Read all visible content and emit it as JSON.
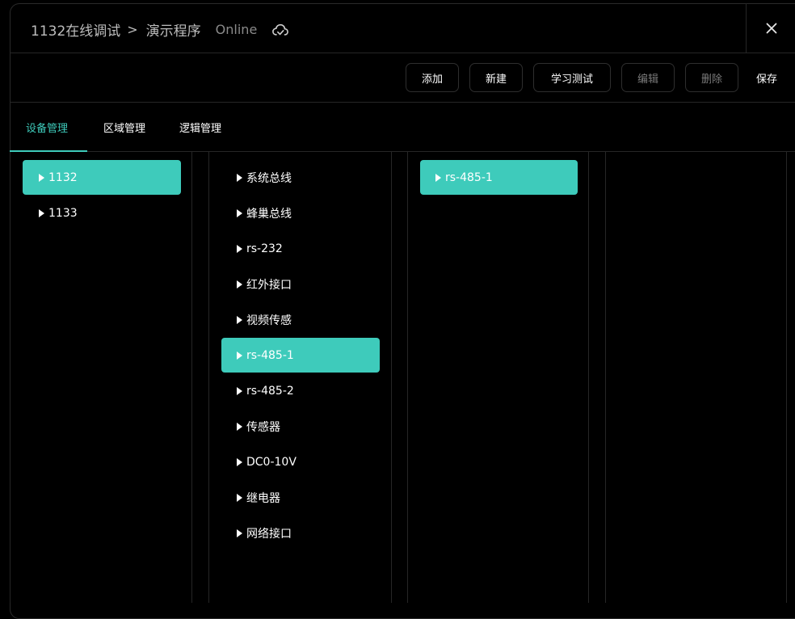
{
  "header": {
    "breadcrumb_root": "1132在线调试",
    "breadcrumb_sep": ">",
    "breadcrumb_current": "演示程序",
    "status": "Online",
    "cloud_icon": "cloud-sync-icon",
    "close_icon": "close-icon"
  },
  "toolbar": {
    "add": "添加",
    "new": "新建",
    "learn_test": "学习测试",
    "edit": "编辑",
    "delete": "删除",
    "save": "保存"
  },
  "tabs": [
    {
      "label": "设备管理",
      "active": true
    },
    {
      "label": "区域管理",
      "active": false
    },
    {
      "label": "逻辑管理",
      "active": false
    }
  ],
  "devices": [
    {
      "label": "1132",
      "selected": true
    },
    {
      "label": "1133",
      "selected": false
    }
  ],
  "interfaces": [
    {
      "label": "系统总线",
      "selected": false
    },
    {
      "label": "蜂巢总线",
      "selected": false
    },
    {
      "label": "rs-232",
      "selected": false
    },
    {
      "label": "红外接口",
      "selected": false
    },
    {
      "label": "视频传感",
      "selected": false
    },
    {
      "label": "rs-485-1",
      "selected": true
    },
    {
      "label": "rs-485-2",
      "selected": false
    },
    {
      "label": "传感器",
      "selected": false
    },
    {
      "label": "DC0-10V",
      "selected": false
    },
    {
      "label": "继电器",
      "selected": false
    },
    {
      "label": "网络接口",
      "selected": false
    }
  ],
  "children": [
    {
      "label": "rs-485-1",
      "selected": true
    }
  ],
  "colors": {
    "accent": "#3ecbbb",
    "background": "#000000",
    "border": "#262626",
    "disabled_text": "#7a7a7a"
  }
}
